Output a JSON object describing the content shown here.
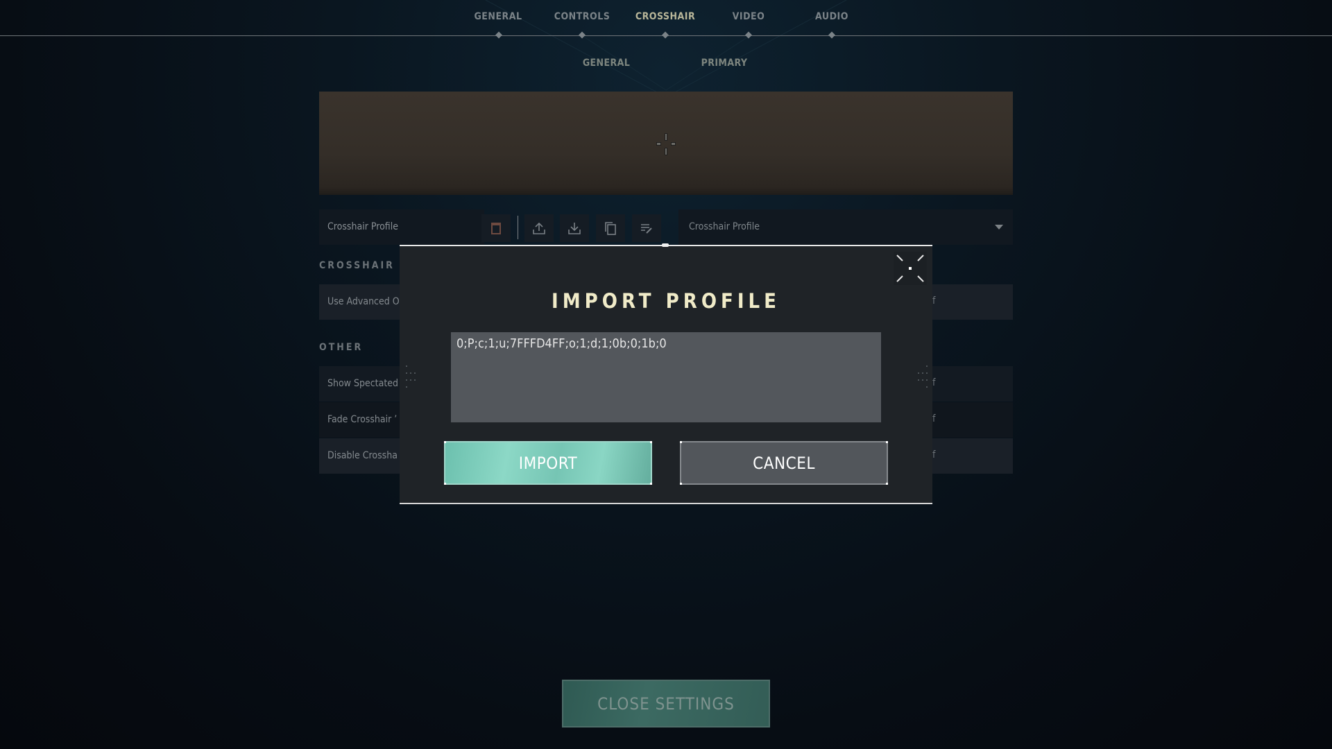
{
  "nav": {
    "tabs": [
      {
        "label": "GENERAL",
        "active": false
      },
      {
        "label": "CONTROLS",
        "active": false
      },
      {
        "label": "CROSSHAIR",
        "active": true
      },
      {
        "label": "VIDEO",
        "active": false
      },
      {
        "label": "AUDIO",
        "active": false
      }
    ],
    "subtabs": [
      {
        "label": "GENERAL"
      },
      {
        "label": "PRIMARY"
      }
    ]
  },
  "profile_bar": {
    "label": "Crosshair Profile",
    "dropdown_value": "Crosshair Profile",
    "icons": [
      "delete-icon",
      "export-icon",
      "import-icon",
      "copy-icon",
      "rename-icon"
    ]
  },
  "sections": {
    "crosshair": {
      "title": "CROSSHAIR",
      "rows": [
        {
          "label": "Use Advanced O",
          "value": "f"
        }
      ]
    },
    "other": {
      "title": "OTHER",
      "rows": [
        {
          "label": "Show Spectated",
          "value": "f"
        },
        {
          "label": "Fade Crosshair ’",
          "value": "f"
        },
        {
          "label": "Disable Crossha",
          "value": "f"
        }
      ]
    }
  },
  "modal": {
    "title": "IMPORT PROFILE",
    "input_value": "0;P;c;1;u;7FFFD4FF;o;1;d;1;0b;0;1b;0",
    "import_label": "IMPORT",
    "cancel_label": "CANCEL"
  },
  "footer": {
    "close_label": "CLOSE SETTINGS"
  },
  "colors": {
    "accent": "#7FD4C2",
    "title": "#F0EBC8",
    "active_tab": "#B9B79A"
  }
}
